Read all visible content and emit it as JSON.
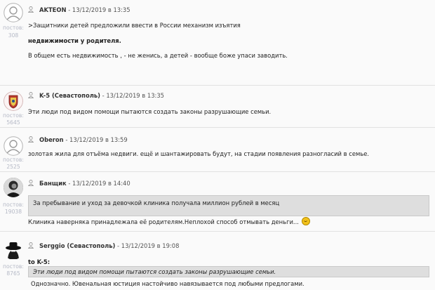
{
  "labels": {
    "posts_word": "постов:"
  },
  "posts": [
    {
      "author": "AKTEON",
      "separator": "-",
      "date": "13/12/2019 в 13:35",
      "post_count": "308",
      "lines": [
        ">Защитники детей предложили ввести в России механизм изъятия",
        "недвижимости у родителя.",
        "В общем есть недвижимость , - не женись, а детей - вообще боже упаси заводить."
      ]
    },
    {
      "author": "K-5 (Севастополь)",
      "separator": "-",
      "date": "13/12/2019 в 13:35",
      "post_count": "5645",
      "lines": [
        "Эти люди под видом помощи пытаются создать  законы разрушающие семьи."
      ]
    },
    {
      "author": "Oberon",
      "separator": "-",
      "date": "13/12/2019 в 13:59",
      "post_count": "2525",
      "lines": [
        "золотая жила для отъёма недвиги. ещё и шантажировать будут, на стадии появления разногласий в семье."
      ]
    },
    {
      "author": "Банщик",
      "separator": "-",
      "date": "13/12/2019 в 14:40",
      "post_count": "19038",
      "quote": "За пребывание и уход за девочкой клиника получала миллион рублей в месяц",
      "lines": [
        "Клиника наверняка принадлежала её родителям.Неплохой способ отмывать деньги..."
      ]
    },
    {
      "author": "Serggio (Севастополь)",
      "separator": "-",
      "date": "13/12/2019 в 19:08",
      "post_count": "8765",
      "reply_to": "to K-5:",
      "quote": "Эти люди под видом помощи пытаются создать  законы разрушающие семьи.",
      "lines": [
        "Однозначно. Ювенальная юстиция настойчиво навязывается под любыми предлогами."
      ]
    }
  ]
}
